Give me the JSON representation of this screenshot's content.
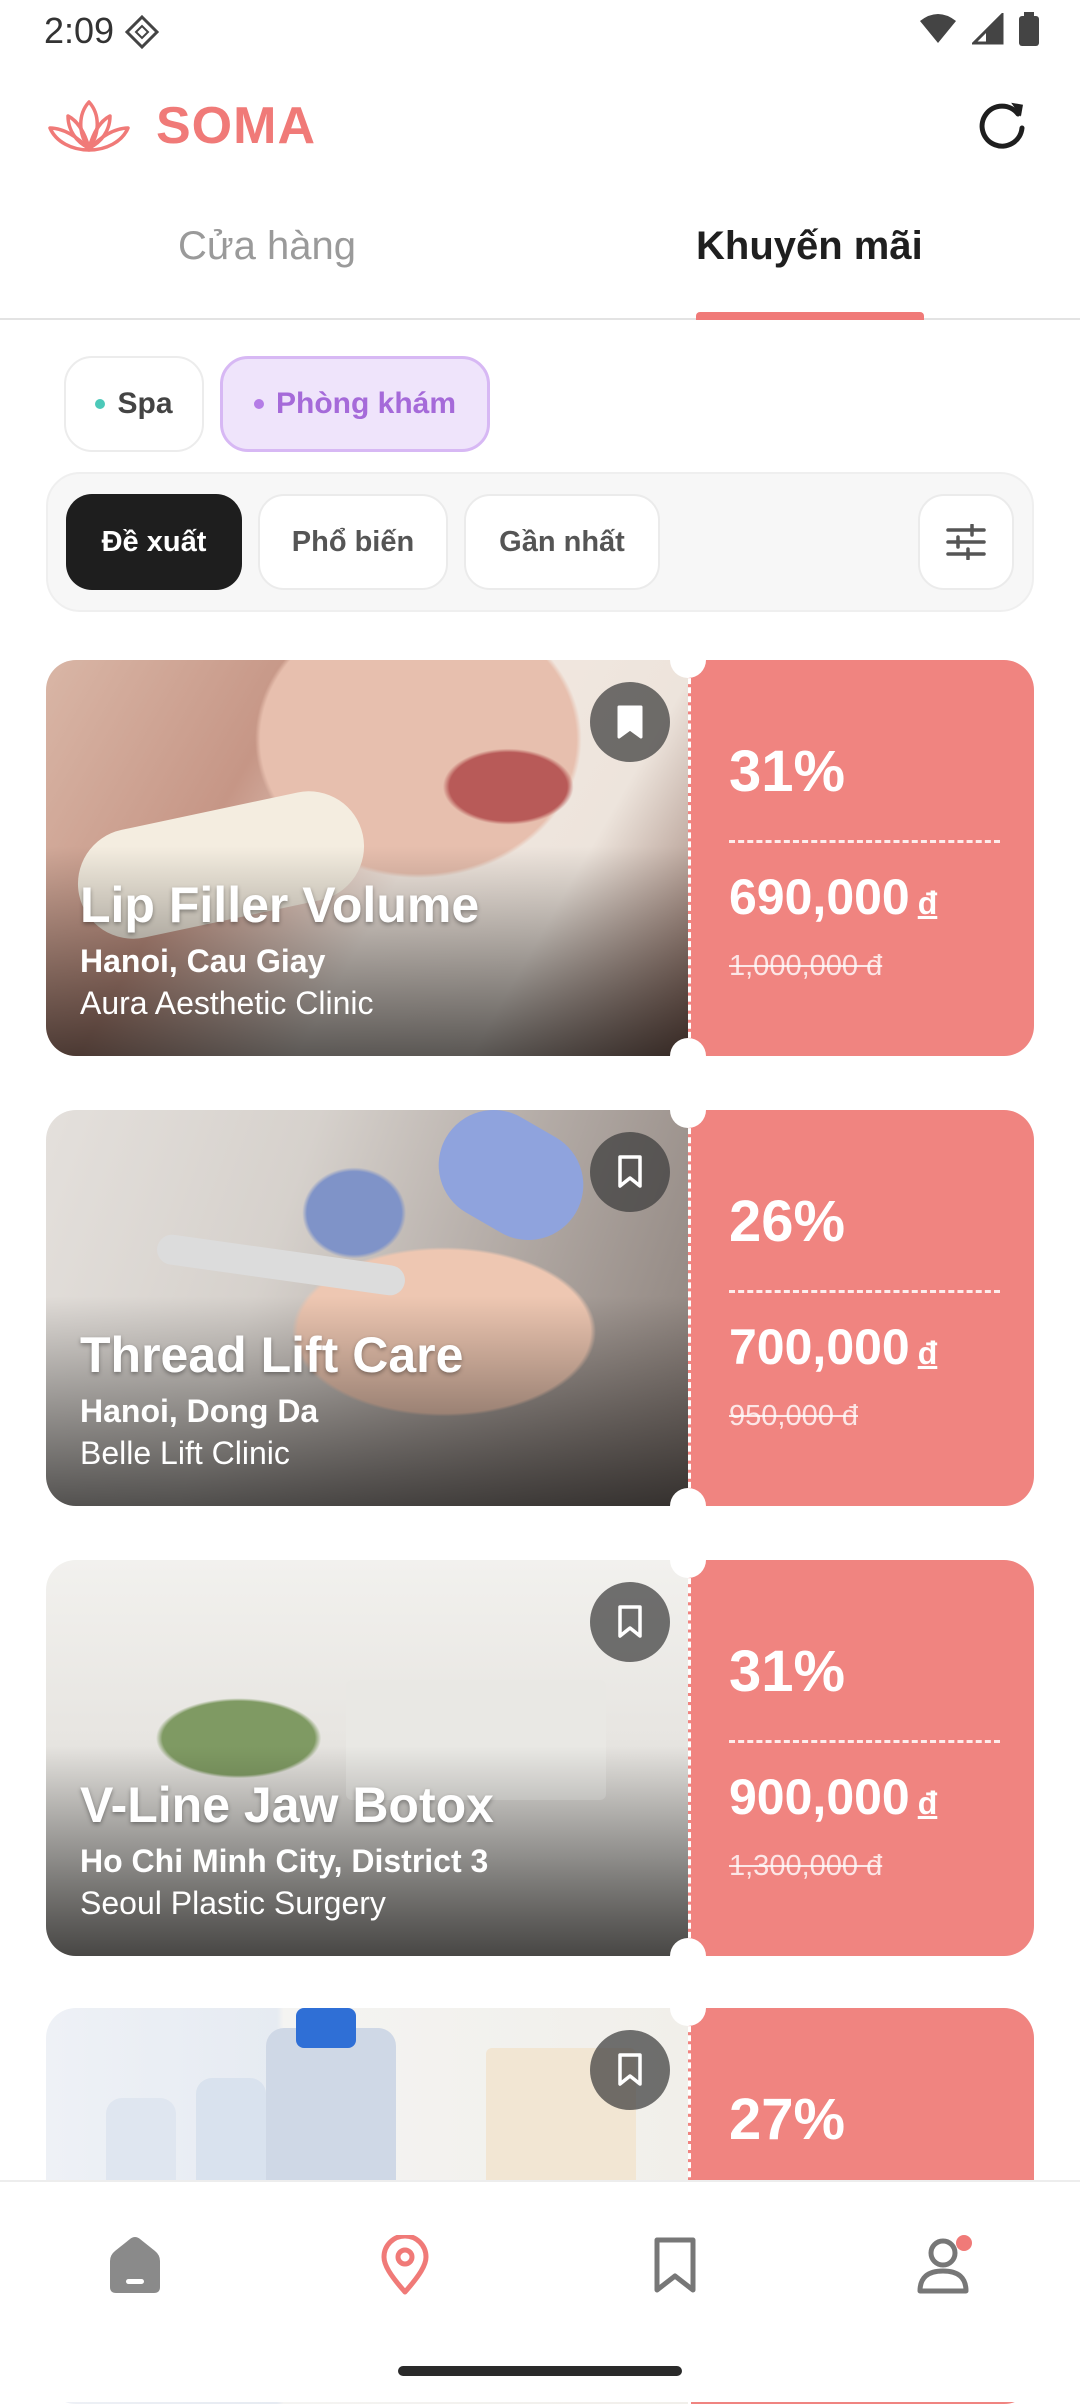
{
  "status_bar": {
    "time": "2:09"
  },
  "header": {
    "app_name": "SOMA",
    "brand_color": "#f07a78"
  },
  "tabs": [
    {
      "label": "Cửa hàng",
      "active": false
    },
    {
      "label": "Khuyến mãi",
      "active": true
    }
  ],
  "categories": [
    {
      "label": "Spa",
      "dot_color": "#4cc9b9",
      "selected": false
    },
    {
      "label": "Phòng khám",
      "dot_color": "#b47ce6",
      "selected": true
    }
  ],
  "sort": {
    "suggested": "Đề xuất",
    "popular": "Phổ biến",
    "nearest": "Gần nhất",
    "selected": "Đề xuất"
  },
  "deals": [
    {
      "title": "Lip Filler Volume",
      "location": "Hanoi, Cau Giay",
      "clinic": "Aura Aesthetic Clinic",
      "discount": "31%",
      "price": "690,000",
      "currency": "đ",
      "old_price": "1,000,000 đ",
      "bookmarked": true
    },
    {
      "title": "Thread Lift Care",
      "location": "Hanoi, Dong Da",
      "clinic": "Belle Lift Clinic",
      "discount": "26%",
      "price": "700,000",
      "currency": "đ",
      "old_price": "950,000 đ",
      "bookmarked": false
    },
    {
      "title": "V-Line Jaw Botox",
      "location": "Ho Chi Minh City, District 3",
      "clinic": "Seoul Plastic Surgery",
      "discount": "31%",
      "price": "900,000",
      "currency": "đ",
      "old_price": "1,300,000 đ",
      "bookmarked": false
    },
    {
      "title": "",
      "location": "",
      "clinic": "",
      "discount": "27%",
      "price": "",
      "currency": "",
      "old_price": "",
      "bookmarked": false
    }
  ],
  "bottom_nav": [
    {
      "icon": "home-icon",
      "active": false
    },
    {
      "icon": "map-pin-icon",
      "active": true
    },
    {
      "icon": "bookmark-icon",
      "active": false
    },
    {
      "icon": "profile-icon",
      "active": false,
      "has_notification": true
    }
  ]
}
